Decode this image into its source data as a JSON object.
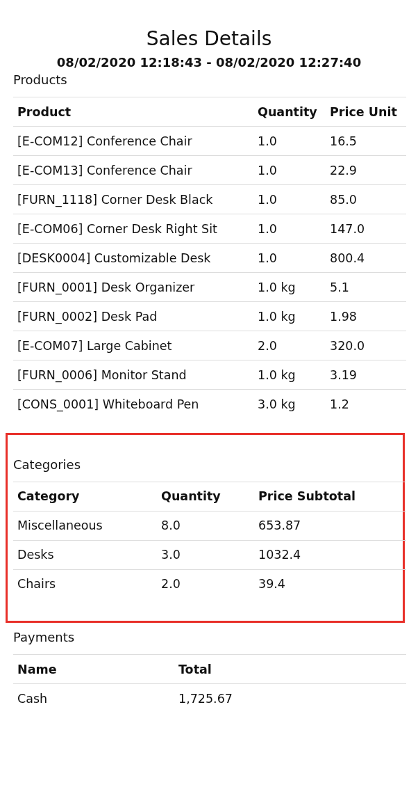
{
  "title": "Sales Details",
  "date_range": "08/02/2020 12:18:43 - 08/02/2020 12:27:40",
  "sections": [
    {
      "label": "Products",
      "highlighted": false,
      "columns": [
        "Product",
        "Quantity",
        "Price Unit"
      ],
      "rows": [
        [
          "[E-COM12] Conference Chair",
          "1.0",
          "16.5"
        ],
        [
          "[E-COM13] Conference Chair",
          "1.0",
          "22.9"
        ],
        [
          "[FURN_1118] Corner Desk Black",
          "1.0",
          "85.0"
        ],
        [
          "[E-COM06] Corner Desk Right Sit",
          "1.0",
          "147.0"
        ],
        [
          "[DESK0004] Customizable Desk",
          "1.0",
          "800.4"
        ],
        [
          "[FURN_0001] Desk Organizer",
          "1.0 kg",
          "5.1"
        ],
        [
          "[FURN_0002] Desk Pad",
          "1.0 kg",
          "1.98"
        ],
        [
          "[E-COM07] Large Cabinet",
          "2.0",
          "320.0"
        ],
        [
          "[FURN_0006] Monitor Stand",
          "1.0 kg",
          "3.19"
        ],
        [
          "[CONS_0001] Whiteboard Pen",
          "3.0 kg",
          "1.2"
        ]
      ]
    },
    {
      "label": "Categories",
      "highlighted": true,
      "columns": [
        "Category",
        "Quantity",
        "Price Subtotal"
      ],
      "rows": [
        [
          "Miscellaneous",
          "8.0",
          "653.87"
        ],
        [
          "Desks",
          "3.0",
          "1032.4"
        ],
        [
          "Chairs",
          "2.0",
          "39.4"
        ]
      ]
    },
    {
      "label": "Payments",
      "highlighted": false,
      "columns": [
        "Name",
        "Total"
      ],
      "rows": [
        [
          "Cash",
          "1,725.67"
        ]
      ]
    }
  ]
}
